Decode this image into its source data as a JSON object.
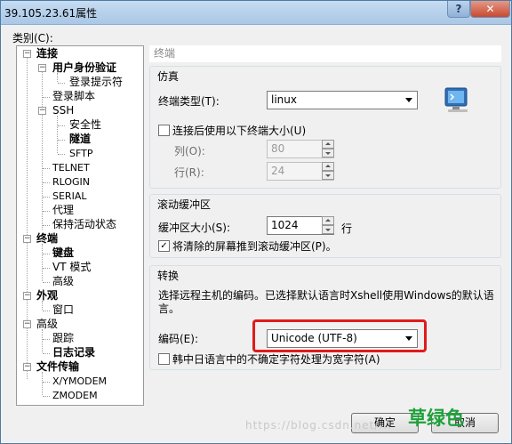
{
  "window": {
    "title": "39.105.23.61属性",
    "help_label": "?",
    "close_label": "✕"
  },
  "category": {
    "label": "类别(C):",
    "tree": [
      {
        "label": "连接",
        "bold": true,
        "expander": "−"
      },
      {
        "label": "用户身份验证",
        "bold": true,
        "expander": "−"
      },
      {
        "label": "登录提示符",
        "bold": false
      },
      {
        "label": "登录脚本",
        "bold": false
      },
      {
        "label": "SSH",
        "bold": false,
        "expander": "−"
      },
      {
        "label": "安全性",
        "bold": false
      },
      {
        "label": "隧道",
        "bold": true
      },
      {
        "label": "SFTP",
        "bold": false
      },
      {
        "label": "TELNET",
        "bold": false
      },
      {
        "label": "RLOGIN",
        "bold": false
      },
      {
        "label": "SERIAL",
        "bold": false
      },
      {
        "label": "代理",
        "bold": false
      },
      {
        "label": "保持活动状态",
        "bold": false
      },
      {
        "label": "终端",
        "bold": true,
        "expander": "−"
      },
      {
        "label": "键盘",
        "bold": true
      },
      {
        "label": "VT 模式",
        "bold": false
      },
      {
        "label": "高级",
        "bold": false
      },
      {
        "label": "外观",
        "bold": true,
        "expander": "−"
      },
      {
        "label": "窗口",
        "bold": false
      },
      {
        "label": "高级",
        "bold": false,
        "expander": "−"
      },
      {
        "label": "跟踪",
        "bold": false
      },
      {
        "label": "日志记录",
        "bold": true
      },
      {
        "label": "文件传输",
        "bold": true,
        "expander": "−"
      },
      {
        "label": "X/YMODEM",
        "bold": false
      },
      {
        "label": "ZMODEM",
        "bold": false
      }
    ]
  },
  "panel": {
    "header": "终端",
    "emulation": {
      "title": "仿真",
      "terminal_type_label": "终端类型(T):",
      "terminal_type_value": "linux",
      "use_size_label": "连接后使用以下终端大小(U)",
      "use_size_checked": false,
      "cols_label": "列(O):",
      "cols_value": "80",
      "rows_label": "行(R):",
      "rows_value": "24"
    },
    "scrollback": {
      "title": "滚动缓冲区",
      "buffer_size_label": "缓冲区大小(S):",
      "buffer_size_value": "1024",
      "buffer_size_unit": "行",
      "push_cleared_label": "将清除的屏幕推到滚动缓冲区(P)。",
      "push_cleared_checked": true,
      "check_mark": "✓"
    },
    "translation": {
      "title": "转换",
      "description": "选择远程主机的编码。已选择默认语言时Xshell使用Windows的默认语言。",
      "encoding_label": "编码(E):",
      "encoding_value": "Unicode (UTF-8)",
      "cjk_label": "韩中日语言中的不确定字符处理为宽字符(A)",
      "cjk_checked": false
    }
  },
  "buttons": {
    "ok_label": "确定",
    "cancel_label": "取消"
  },
  "watermark": {
    "url": "https://blog.csdn.net/...",
    "brand": "草绿色"
  },
  "colors": {
    "highlight": "#e01b1b",
    "title_bar": "#b8d1ec",
    "watermark_green": "#1ea13b"
  }
}
